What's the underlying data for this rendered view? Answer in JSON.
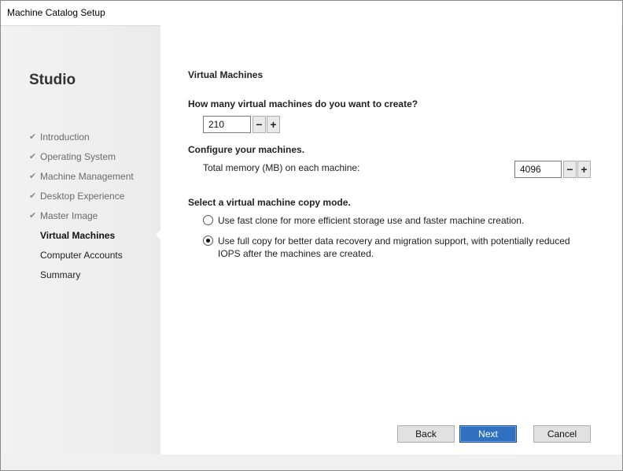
{
  "window": {
    "title": "Machine Catalog Setup"
  },
  "sidebar": {
    "brand": "Studio",
    "steps": [
      {
        "label": "Introduction",
        "state": "done"
      },
      {
        "label": "Operating System",
        "state": "done"
      },
      {
        "label": "Machine Management",
        "state": "done"
      },
      {
        "label": "Desktop Experience",
        "state": "done"
      },
      {
        "label": "Master Image",
        "state": "done"
      },
      {
        "label": "Virtual Machines",
        "state": "current"
      },
      {
        "label": "Computer Accounts",
        "state": "upcoming"
      },
      {
        "label": "Summary",
        "state": "upcoming"
      }
    ],
    "check_glyph": "✔"
  },
  "page": {
    "title": "Virtual Machines",
    "vm_count": {
      "question": "How many virtual machines do you want to create?",
      "value": "210",
      "minus": "−",
      "plus": "+"
    },
    "configure": {
      "heading": "Configure your machines.",
      "memory_label": "Total memory (MB) on each machine:",
      "memory_value": "4096",
      "minus": "−",
      "plus": "+"
    },
    "copy_mode": {
      "heading": "Select a virtual machine copy mode.",
      "options": [
        {
          "label": "Use fast clone for more efficient storage use and faster machine creation.",
          "selected": false
        },
        {
          "label_line1": "Use full copy for better data recovery and migration support, with potentially reduced",
          "label_line2": "IOPS after the machines are created.",
          "selected": true
        }
      ]
    }
  },
  "buttons": {
    "back": "Back",
    "next": "Next",
    "cancel": "Cancel"
  },
  "colors": {
    "primary_button": "#2f71c0",
    "sidebar_bg": "#f0f0f0"
  }
}
